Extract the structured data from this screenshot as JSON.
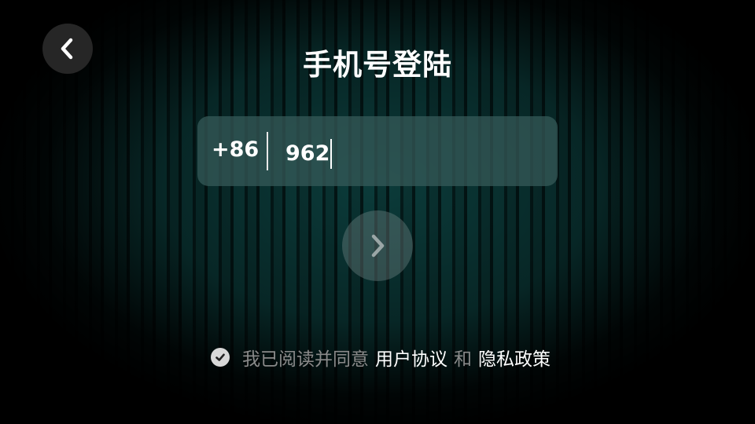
{
  "header": {
    "title": "手机号登陆",
    "back_icon": "chevron-left-icon"
  },
  "phone_form": {
    "country_code": "+86",
    "phone_value": "962"
  },
  "next_button": {
    "icon": "chevron-right-icon"
  },
  "agreement": {
    "checked": true,
    "prefix_text": "我已阅读并同意",
    "user_agreement_label": "用户协议",
    "and_text": "和",
    "privacy_policy_label": "隐私政策"
  },
  "colors": {
    "background_teal": "#0b3b3a",
    "input_box": "#385c5a",
    "muted_text": "#8a8a8a"
  }
}
